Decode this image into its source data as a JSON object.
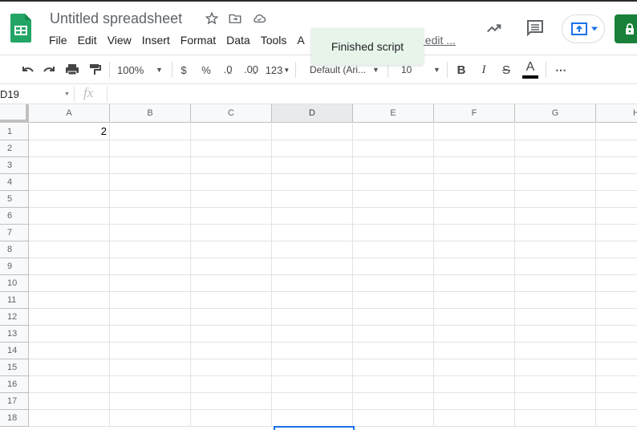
{
  "app": {
    "title": "Untitled spreadsheet",
    "menu": [
      "File",
      "Edit",
      "View",
      "Insert",
      "Format",
      "Data",
      "Tools",
      "A"
    ],
    "last_edit": "t edit ...",
    "toast": "Finished script"
  },
  "toolbar": {
    "zoom": "100%",
    "currency": "$",
    "percent": "%",
    "decrease_decimal": ".0",
    "increase_decimal": ".00",
    "more_formats": "123",
    "font": "Default (Ari...",
    "font_size": "10",
    "bold": "B",
    "italic": "I",
    "strike": "S",
    "text_color_label": "A",
    "text_color": "#000000",
    "more": "⋯"
  },
  "formula_bar": {
    "name_box": "D19",
    "fx": "fx",
    "value": ""
  },
  "grid": {
    "columns": [
      "A",
      "B",
      "C",
      "D",
      "E",
      "F",
      "G",
      "H"
    ],
    "selected_column": "D",
    "rows": [
      "1",
      "2",
      "3",
      "4",
      "5",
      "6",
      "7",
      "8",
      "9",
      "10",
      "11",
      "12",
      "13",
      "14",
      "15",
      "16",
      "17",
      "18"
    ],
    "cells": {
      "A1": "2"
    },
    "selected_cell": "D19"
  },
  "colors": {
    "accent": "#1a73e8",
    "brand_green": "#188038",
    "toast_bg": "#e6f4ea"
  }
}
